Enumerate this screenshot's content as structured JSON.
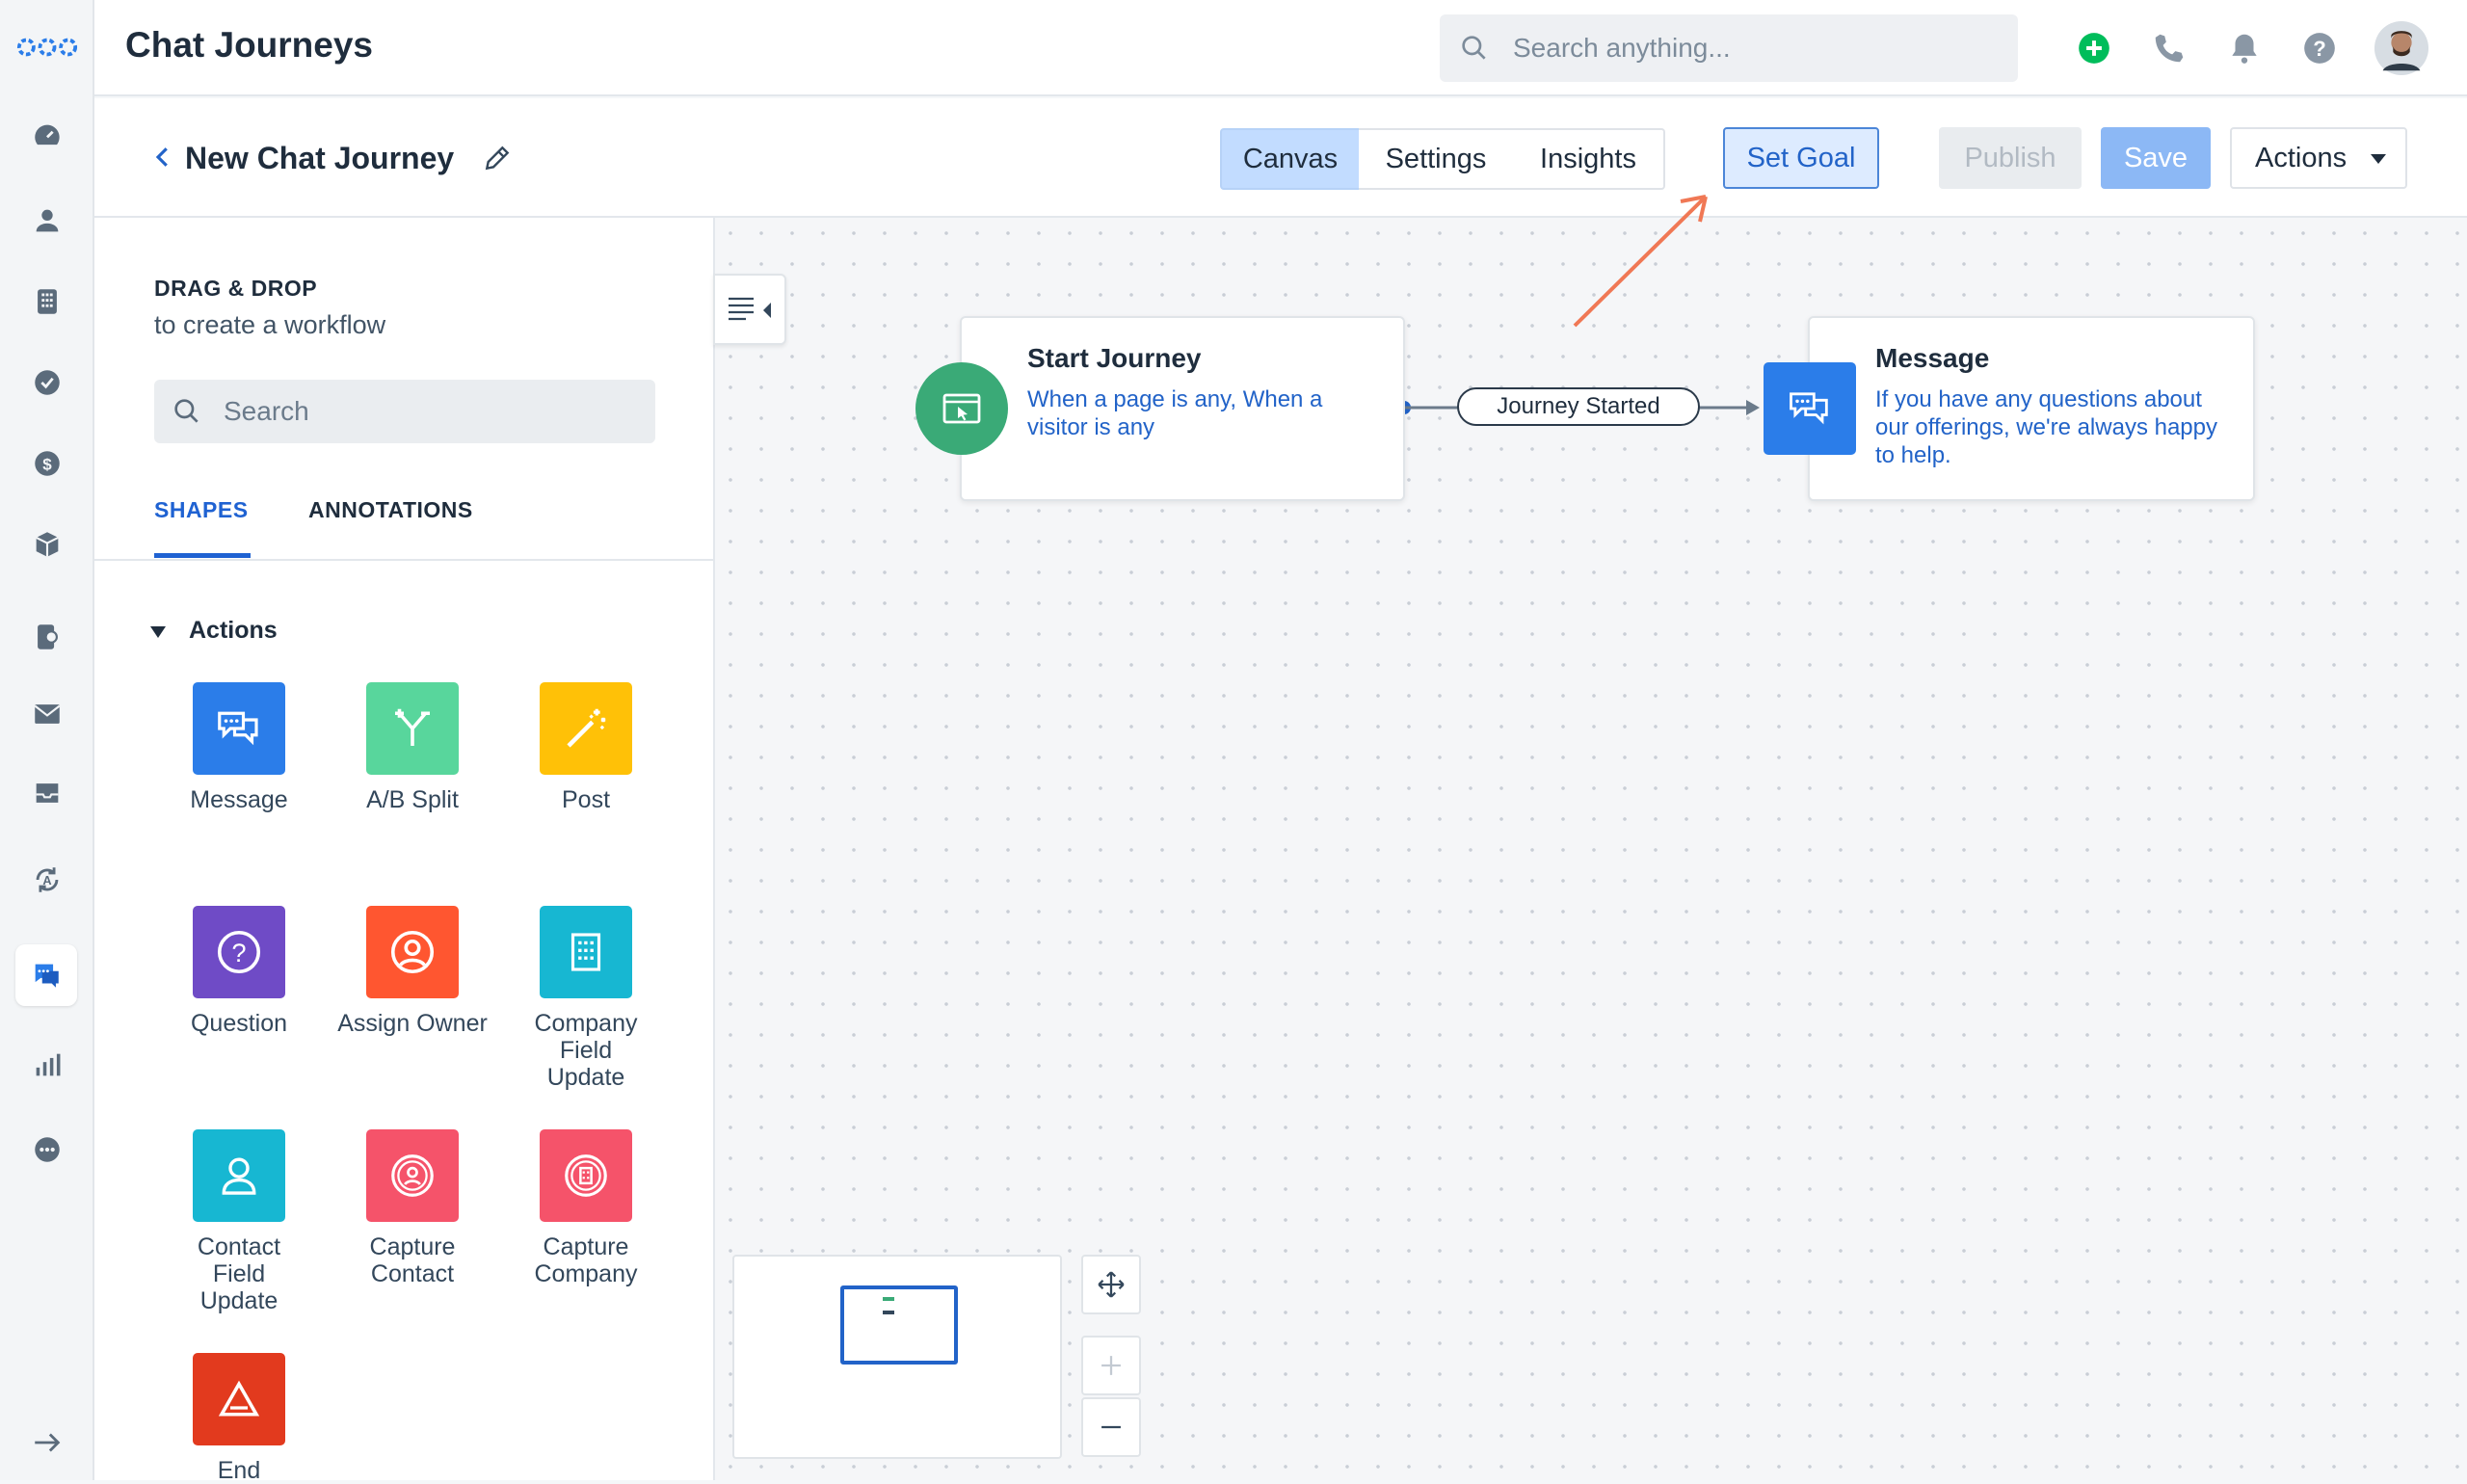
{
  "header": {
    "app_title": "Chat Journeys",
    "search_placeholder": "Search anything..."
  },
  "journey": {
    "name": "New Chat Journey"
  },
  "view_tabs": [
    {
      "label": "Canvas",
      "active": true
    },
    {
      "label": "Settings",
      "active": false
    },
    {
      "label": "Insights",
      "active": false
    }
  ],
  "buttons": {
    "set_goal": "Set Goal",
    "publish": "Publish",
    "save": "Save",
    "actions": "Actions"
  },
  "panel": {
    "title": "DRAG & DROP",
    "subtitle": "to create a workflow",
    "search_placeholder": "Search",
    "tabs": [
      "SHAPES",
      "ANNOTATIONS"
    ],
    "section": "Actions",
    "shapes": [
      {
        "label": "Message",
        "color": "#2b7de9",
        "icon": "chat-icon"
      },
      {
        "label": "A/B Split",
        "color": "#58d69c",
        "icon": "split-icon"
      },
      {
        "label": "Post",
        "color": "#ffc107",
        "icon": "magic-wand-icon"
      },
      {
        "label": "Question",
        "color": "#6f4bc6",
        "icon": "question-icon"
      },
      {
        "label": "Assign Owner",
        "color": "#ff5630",
        "icon": "user-circle-icon"
      },
      {
        "label": "Company Field Update",
        "color": "#17b7d2",
        "icon": "building-icon"
      },
      {
        "label": "Contact Field Update",
        "color": "#17b7d2",
        "icon": "user-icon"
      },
      {
        "label": "Capture Contact",
        "color": "#f5536a",
        "icon": "capture-contact-icon"
      },
      {
        "label": "Capture Company",
        "color": "#f5536a",
        "icon": "capture-company-icon"
      },
      {
        "label": "End",
        "color": "#e23a1e",
        "icon": "triangle-icon"
      }
    ]
  },
  "canvas": {
    "start_node": {
      "title": "Start Journey",
      "description": "When a page is any, When a visitor is any",
      "icon_color": "#3aaa77"
    },
    "connector_label": "Journey Started",
    "message_node": {
      "title": "Message",
      "description": "If you have any questions about our offerings, we're always happy to help.",
      "icon_color": "#2b7de9"
    }
  },
  "colors": {
    "accent": "#1f62d2",
    "annotation_arrow": "#f07855"
  }
}
